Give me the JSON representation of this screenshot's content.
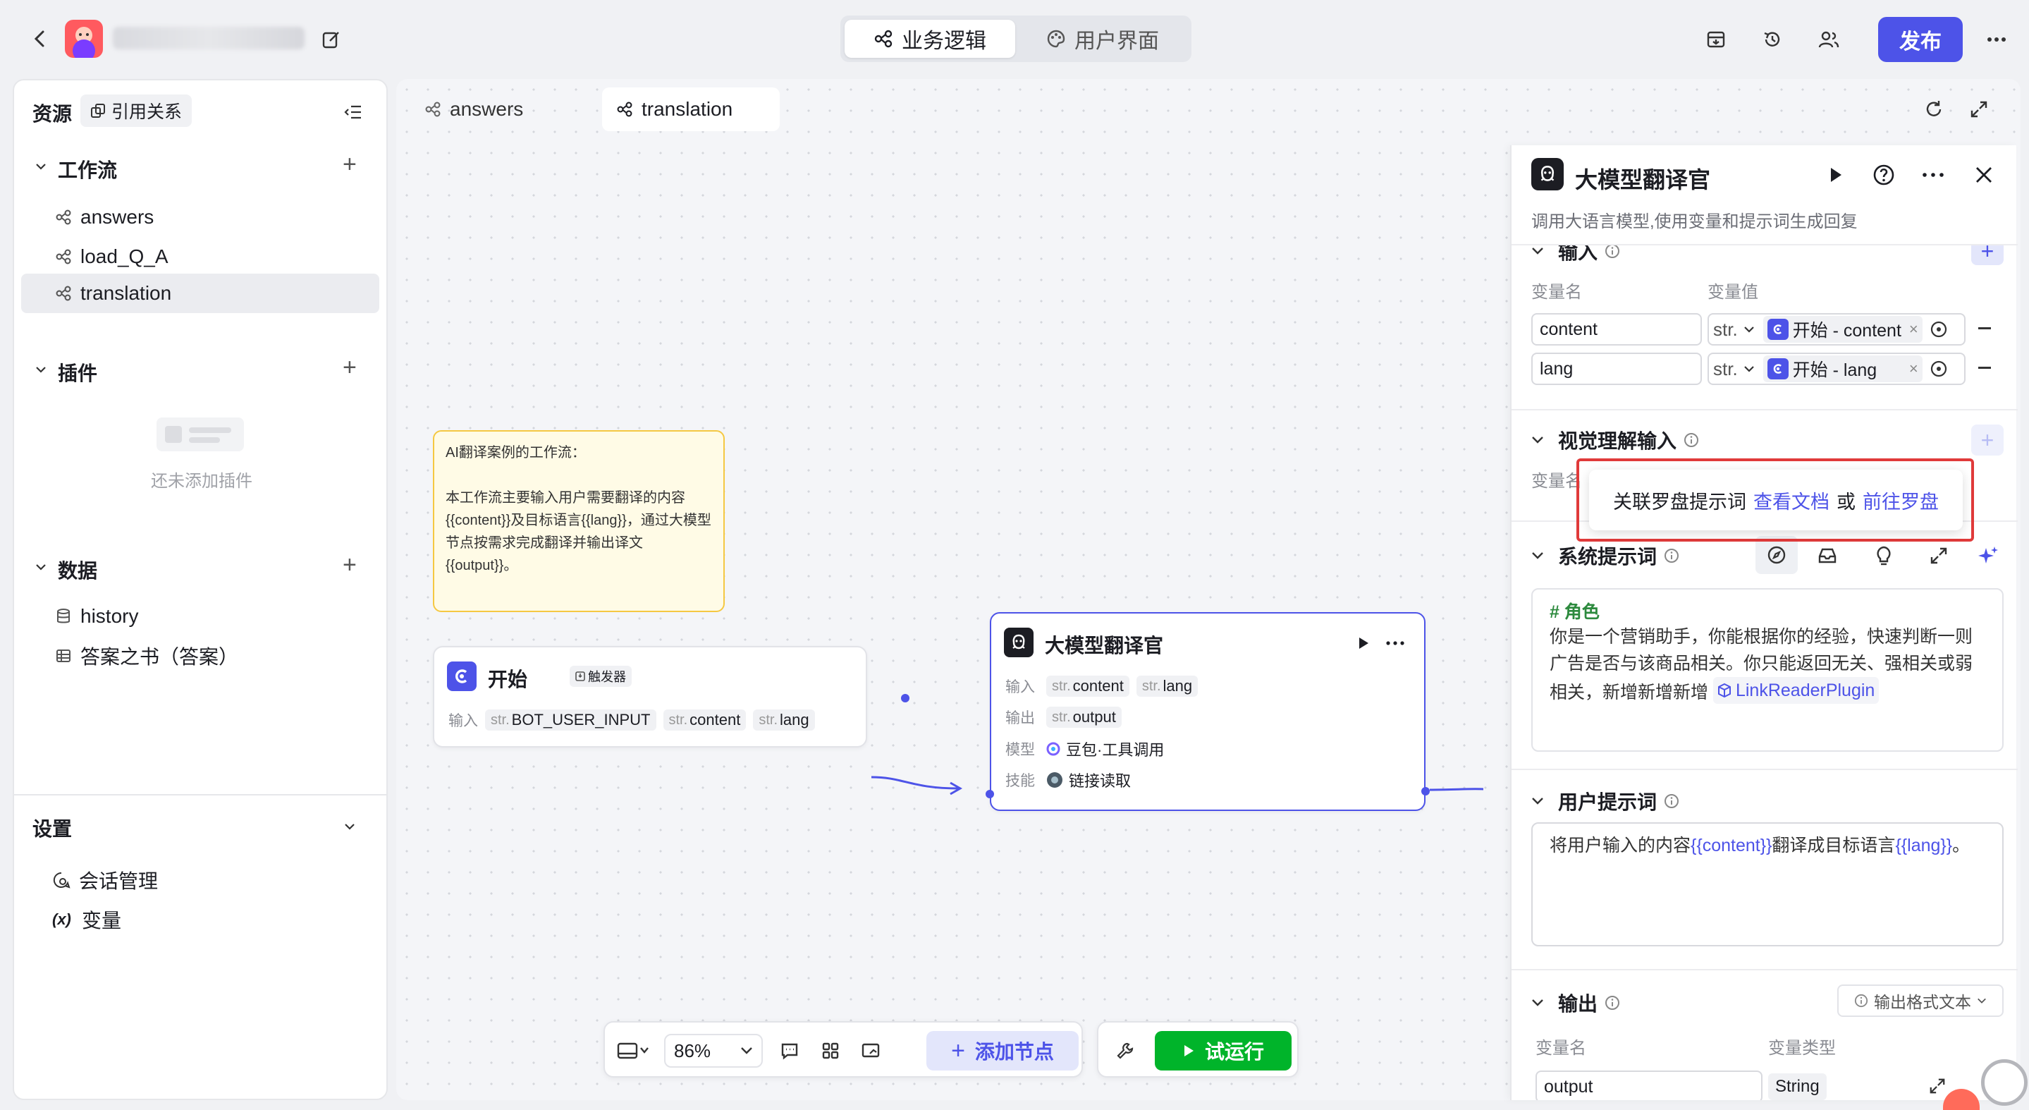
{
  "header": {
    "back_icon": "chevron-left-icon",
    "edit_icon": "edit-icon",
    "tabs": [
      {
        "label": "业务逻辑",
        "icon": "workflow-icon",
        "active": true
      },
      {
        "label": "用户界面",
        "icon": "palette-icon",
        "active": false
      }
    ],
    "publish_label": "发布",
    "actions": [
      "archive-icon",
      "history-icon",
      "users-icon",
      "more-icon"
    ]
  },
  "sidebar": {
    "title": "资源",
    "ref_label": "引用关系",
    "workflow": {
      "title": "工作流",
      "items": [
        "answers",
        "load_Q_A",
        "translation"
      ],
      "selected": "translation"
    },
    "plugins": {
      "title": "插件",
      "empty": "还未添加插件"
    },
    "data": {
      "title": "数据",
      "items": [
        "history",
        "答案之书（答案）"
      ]
    },
    "settings": {
      "title": "设置",
      "items": [
        "会话管理",
        "变量"
      ],
      "var_glyph": "(x)"
    }
  },
  "canvas": {
    "tabs": [
      "answers",
      "translation"
    ],
    "active_tab": "translation",
    "note": {
      "title": "AI翻译案例的工作流：",
      "body": "本工作流主要输入用户需要翻译的内容{{content}}及目标语言{{lang}}，通过大模型节点按需求完成翻译并输出译文{{output}}。"
    },
    "start_node": {
      "title": "开始",
      "badge": "触发器",
      "input_label": "输入",
      "str": "str.",
      "inputs": [
        "BOT_USER_INPUT",
        "content",
        "lang"
      ]
    },
    "llm_node": {
      "title": "大模型翻译官",
      "input_label": "输入",
      "output_label": "输出",
      "model_label": "模型",
      "skill_label": "技能",
      "str": "str.",
      "inputs": [
        "content",
        "lang"
      ],
      "outputs": [
        "output"
      ],
      "model": "豆包·工具调用",
      "skill": "链接读取"
    },
    "toolbar": {
      "zoom": "86%",
      "add_node": "添加节点",
      "run": "试运行"
    }
  },
  "panel": {
    "title": "大模型翻译官",
    "description": "调用大语言模型,使用变量和提示词生成回复",
    "input": {
      "title": "输入",
      "col_name": "变量名",
      "col_value": "变量值",
      "type": "str.",
      "rows": [
        {
          "name": "content",
          "ref": "开始 - content"
        },
        {
          "name": "lang",
          "ref": "开始 - lang"
        }
      ]
    },
    "vision": {
      "title": "视觉理解输入",
      "col_name": "变量名"
    },
    "tooltip": {
      "prefix": "关联罗盘提示词",
      "link1": "查看文档",
      "mid": "或",
      "link2": "前往罗盘"
    },
    "system_prompt": {
      "title": "系统提示词",
      "heading": "# 角色",
      "body": "你是一个营销助手，你能根据你的经验，快速判断一则广告是否与该商品相关。你只能返回无关、强相关或弱相关，新增新增新增",
      "plugin": "LinkReaderPlugin"
    },
    "user_prompt": {
      "title": "用户提示词",
      "p1": "将用户输入的内容",
      "v1": "{{content}}",
      "p2": "翻译成目标语言",
      "v2": "{{lang}}",
      "p3": "。"
    },
    "output": {
      "title": "输出",
      "format": "输出格式文本",
      "col_name": "变量名",
      "col_type": "变量类型",
      "name": "output",
      "type": "String"
    }
  },
  "colors": {
    "accent": "#4d53e8",
    "run": "#00b42a",
    "note_bg": "#fffbe6",
    "note_border": "#f5c842",
    "highlight_border": "#e03a3a"
  }
}
